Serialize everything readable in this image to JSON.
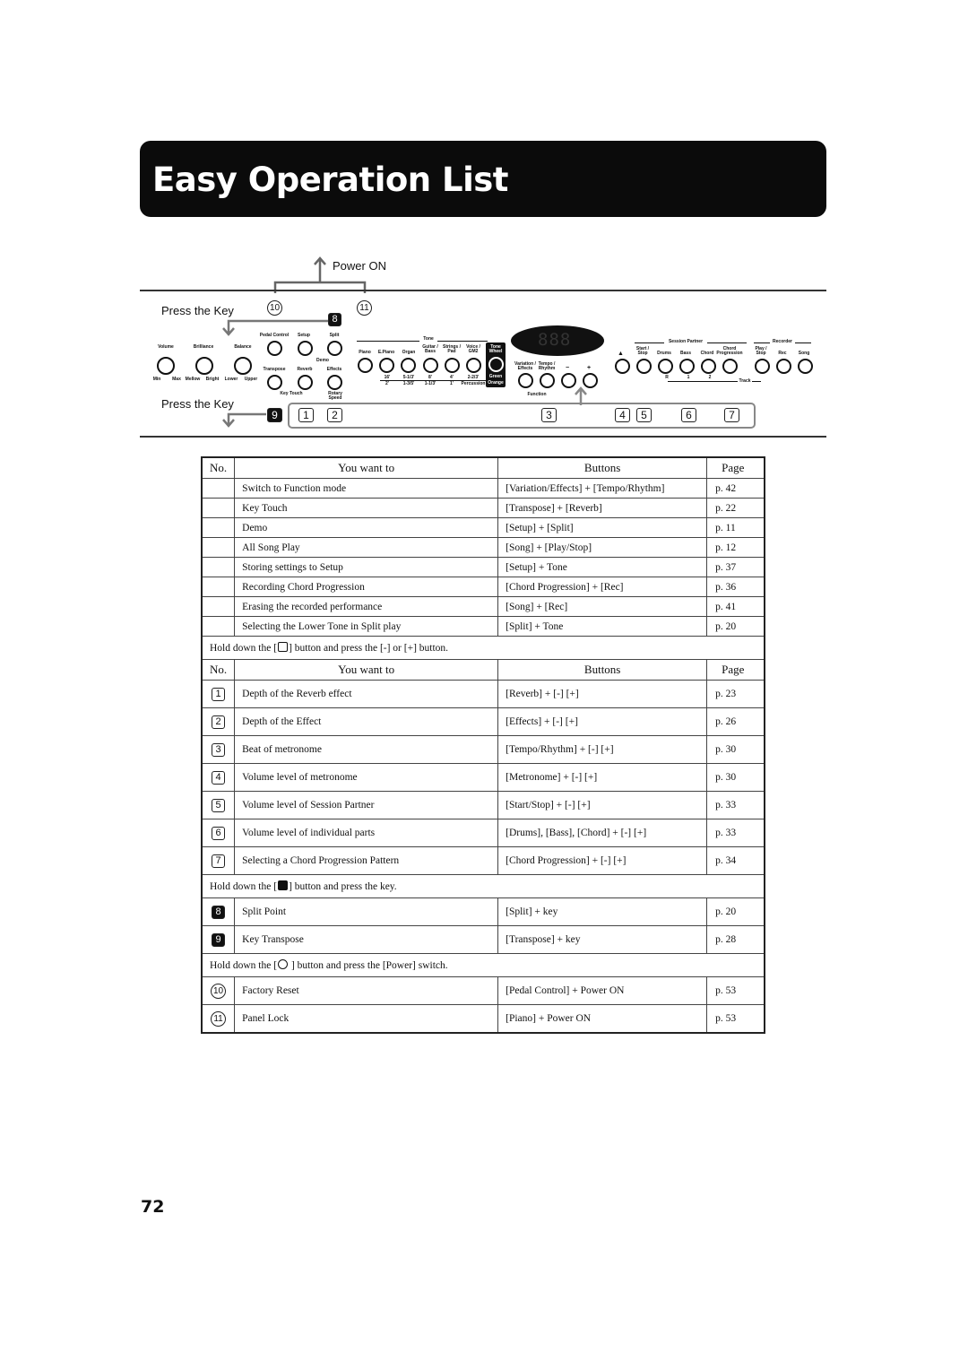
{
  "header": {
    "title": "Easy Operation List"
  },
  "diagram": {
    "power_on_label": "Power ON",
    "press_key_label_top": "Press the Key",
    "press_key_label_bottom": "Press the Key",
    "top_markers": [
      "10",
      "11"
    ],
    "marker_8": "8",
    "marker_9": "9",
    "bottom_markers": [
      "1",
      "2",
      "3",
      "4",
      "5",
      "6",
      "7"
    ],
    "knobs": [
      {
        "label": "Volume",
        "min": "Min",
        "max": "Max"
      },
      {
        "label": "Brilliance",
        "min": "Mellow",
        "max": "Bright"
      },
      {
        "label": "Balance",
        "min": "Lower",
        "max": "Upper"
      }
    ],
    "left_buttons_top": [
      "Pedal Control",
      "Setup",
      "Split"
    ],
    "left_buttons_bottom": [
      "Transpose",
      "Reverb",
      "Effects"
    ],
    "demo_label": "Demo",
    "key_touch_label": "Key Touch",
    "rotary_speed_label": "Rotary Speed",
    "tone_group_label": "Tone",
    "tone_buttons": [
      "Piano",
      "E.Piano",
      "Organ",
      "Guitar / Bass",
      "Strings / Pad",
      "Voice / GM2",
      "Tone Wheel"
    ],
    "tone_footers_top": [
      "16'",
      "5-1/3'",
      "8'",
      "4'",
      "2-2/3'",
      "Green"
    ],
    "tone_footers_bottom": [
      "2'",
      "1-3/5'",
      "1-1/3'",
      "1'",
      "Percussion",
      "Orange"
    ],
    "display_text": "888",
    "mid_buttons": [
      "Variation / Effects",
      "Tempo / Rhythm",
      "−",
      "+"
    ],
    "function_label": "Function",
    "session_partner_label": "Session Partner",
    "session_buttons": [
      "Metronome",
      "Start / Stop",
      "Drums",
      "Bass",
      "Chord",
      "Chord Progression"
    ],
    "recorder_label": "Recorder",
    "recorder_buttons": [
      "Play / Stop",
      "Rec",
      "Song"
    ],
    "track_label": "Track",
    "track_numbers": [
      "R",
      "1",
      "2"
    ]
  },
  "table": {
    "headers": {
      "no": "No.",
      "want": "You want to",
      "buttons": "Buttons",
      "page": "Page"
    },
    "section1_rows": [
      {
        "no": "",
        "want": "Switch to Function mode",
        "buttons": "[Variation/Effects] + [Tempo/Rhythm]",
        "page": "p. 42"
      },
      {
        "no": "",
        "want": "Key Touch",
        "buttons": "[Transpose] + [Reverb]",
        "page": "p. 22"
      },
      {
        "no": "",
        "want": "Demo",
        "buttons": "[Setup] + [Split]",
        "page": "p. 11"
      },
      {
        "no": "",
        "want": "All Song Play",
        "buttons": "[Song] + [Play/Stop]",
        "page": "p. 12"
      },
      {
        "no": "",
        "want": "Storing settings to Setup",
        "buttons": "[Setup] + Tone",
        "page": "p. 37"
      },
      {
        "no": "",
        "want": "Recording Chord Progression",
        "buttons": "[Chord Progression] + [Rec]",
        "page": "p. 36"
      },
      {
        "no": "",
        "want": "Erasing the recorded performance",
        "buttons": "[Song] + [Rec]",
        "page": "p. 41"
      },
      {
        "no": "",
        "want": "Selecting the Lower Tone in Split play",
        "buttons": "[Split] + Tone",
        "page": "p. 20"
      }
    ],
    "note2_pre": "Hold down the [",
    "note2_post": "] button and press the [-] or [+] button.",
    "section2_rows": [
      {
        "no": "1",
        "want": "Depth of the Reverb effect",
        "buttons": "[Reverb] + [-] [+]",
        "page": "p. 23"
      },
      {
        "no": "2",
        "want": "Depth of the Effect",
        "buttons": "[Effects] + [-] [+]",
        "page": "p. 26"
      },
      {
        "no": "3",
        "want": "Beat of metronome",
        "buttons": "[Tempo/Rhythm] + [-] [+]",
        "page": "p. 30"
      },
      {
        "no": "4",
        "want": "Volume level of metronome",
        "buttons": "[Metronome] + [-] [+]",
        "page": "p. 30"
      },
      {
        "no": "5",
        "want": "Volume level of Session Partner",
        "buttons": "[Start/Stop] + [-] [+]",
        "page": "p. 33"
      },
      {
        "no": "6",
        "want": "Volume level of individual parts",
        "buttons": "[Drums], [Bass], [Chord] + [-] [+]",
        "page": "p. 33"
      },
      {
        "no": "7",
        "want": "Selecting a Chord Progression Pattern",
        "buttons": "[Chord Progression] + [-] [+]",
        "page": "p. 34"
      }
    ],
    "note3_pre": "Hold down the [",
    "note3_post": "] button and press the key.",
    "section3_rows": [
      {
        "no": "8",
        "want": "Split Point",
        "buttons": "[Split] + key",
        "page": "p. 20"
      },
      {
        "no": "9",
        "want": "Key Transpose",
        "buttons": "[Transpose] + key",
        "page": "p. 28"
      }
    ],
    "note4_pre": "Hold down the [",
    "note4_post": " ] button and press the [Power] switch.",
    "section4_rows": [
      {
        "no": "10",
        "want": "Factory Reset",
        "buttons": "[Pedal Control] + Power ON",
        "page": "p. 53"
      },
      {
        "no": "11",
        "want": "Panel Lock",
        "buttons": "[Piano] + Power ON",
        "page": "p. 53"
      }
    ]
  },
  "footer": {
    "page_number": "72"
  }
}
